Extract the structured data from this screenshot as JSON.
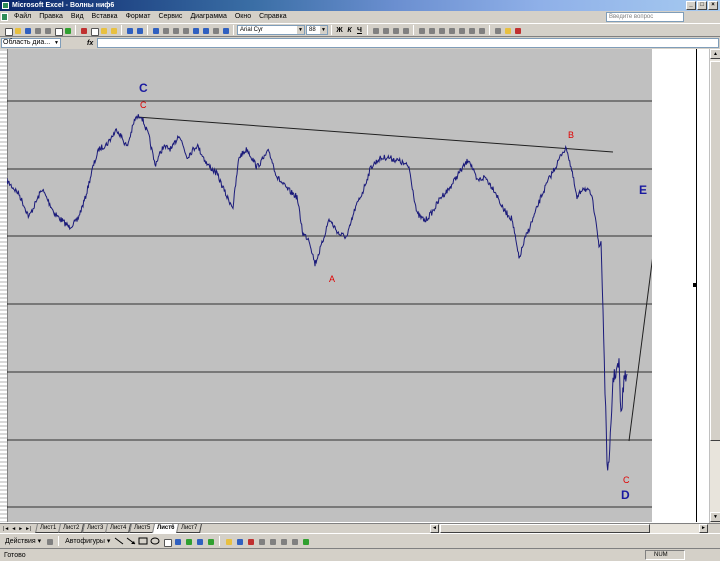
{
  "window": {
    "title": "Microsoft Excel - Волны ниф6"
  },
  "menu": {
    "items": [
      "Файл",
      "Правка",
      "Вид",
      "Вставка",
      "Формат",
      "Сервис",
      "Диаграмма",
      "Окно",
      "Справка"
    ],
    "help_placeholder": "Введите вопрос"
  },
  "toolbar": {
    "font_name": "Arial Cyr",
    "font_size": "88",
    "bold": "Ж",
    "italic": "К",
    "underline": "Ч"
  },
  "formula_bar": {
    "name_box": "Область диа...",
    "fx": "fx"
  },
  "chart": {
    "background": "#c0c0c0",
    "line_color": "#1a1a7a",
    "labels": {
      "C_upper": "C",
      "C_small": "C",
      "A": "A",
      "B": "B",
      "E": "E",
      "C_lower": "C",
      "D": "D"
    },
    "label_colors": {
      "blue": "#1a1aa0",
      "red": "#e00000"
    }
  },
  "sheets": {
    "tabs": [
      "Лист1",
      "Лист2",
      "Лист3",
      "Лист4",
      "Лист5",
      "Лист6",
      "Лист7"
    ],
    "active": "Лист6"
  },
  "drawing": {
    "actions": "Действия ▾",
    "autoshapes": "Автофигуры ▾"
  },
  "status": {
    "ready": "Готово",
    "num": "NUM"
  }
}
